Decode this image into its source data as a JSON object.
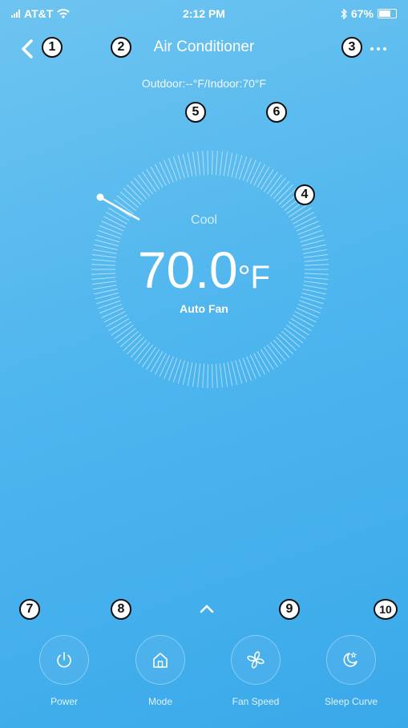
{
  "status_bar": {
    "carrier": "AT&T",
    "time": "2:12 PM",
    "battery": "67%"
  },
  "header": {
    "title": "Air Conditioner"
  },
  "readings": {
    "text": "Outdoor:--°F/Indoor:70°F"
  },
  "thermostat": {
    "mode": "Cool",
    "temperature": "70.0",
    "unit": "°F",
    "fan": "Auto Fan"
  },
  "controls": [
    {
      "label": "Power",
      "icon": "power-icon"
    },
    {
      "label": "Mode",
      "icon": "home-icon"
    },
    {
      "label": "Fan Speed",
      "icon": "fan-icon"
    },
    {
      "label": "Sleep Curve",
      "icon": "moon-star-icon"
    }
  ],
  "annotations": [
    "1",
    "2",
    "3",
    "4",
    "5",
    "6",
    "7",
    "8",
    "9",
    "10"
  ],
  "colors": {
    "background": "#4fb6ee",
    "badge_border": "#111111",
    "text": "#ffffff"
  }
}
